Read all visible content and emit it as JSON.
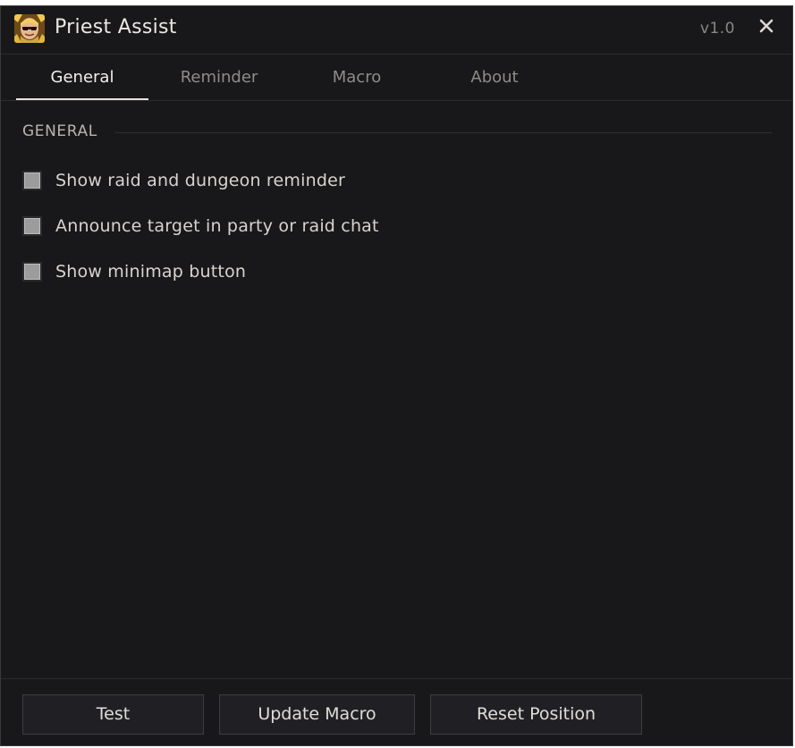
{
  "window": {
    "title": "Priest Assist",
    "version": "v1.0",
    "accent_color": "#e6e3de",
    "background_color": "#18181b",
    "icons": {
      "app": "priest-portrait-icon",
      "close": "close-icon"
    }
  },
  "tabs": [
    {
      "label": "General",
      "active": true
    },
    {
      "label": "Reminder",
      "active": false
    },
    {
      "label": "Macro",
      "active": false
    },
    {
      "label": "About",
      "active": false
    }
  ],
  "general": {
    "section_title": "GENERAL",
    "options": [
      {
        "label": "Show raid and dungeon reminder",
        "checked": false
      },
      {
        "label": "Announce target in party or raid chat",
        "checked": false
      },
      {
        "label": "Show minimap button",
        "checked": false
      }
    ]
  },
  "footer": {
    "buttons": [
      {
        "label": "Test"
      },
      {
        "label": "Update Macro"
      },
      {
        "label": "Reset Position"
      }
    ]
  }
}
